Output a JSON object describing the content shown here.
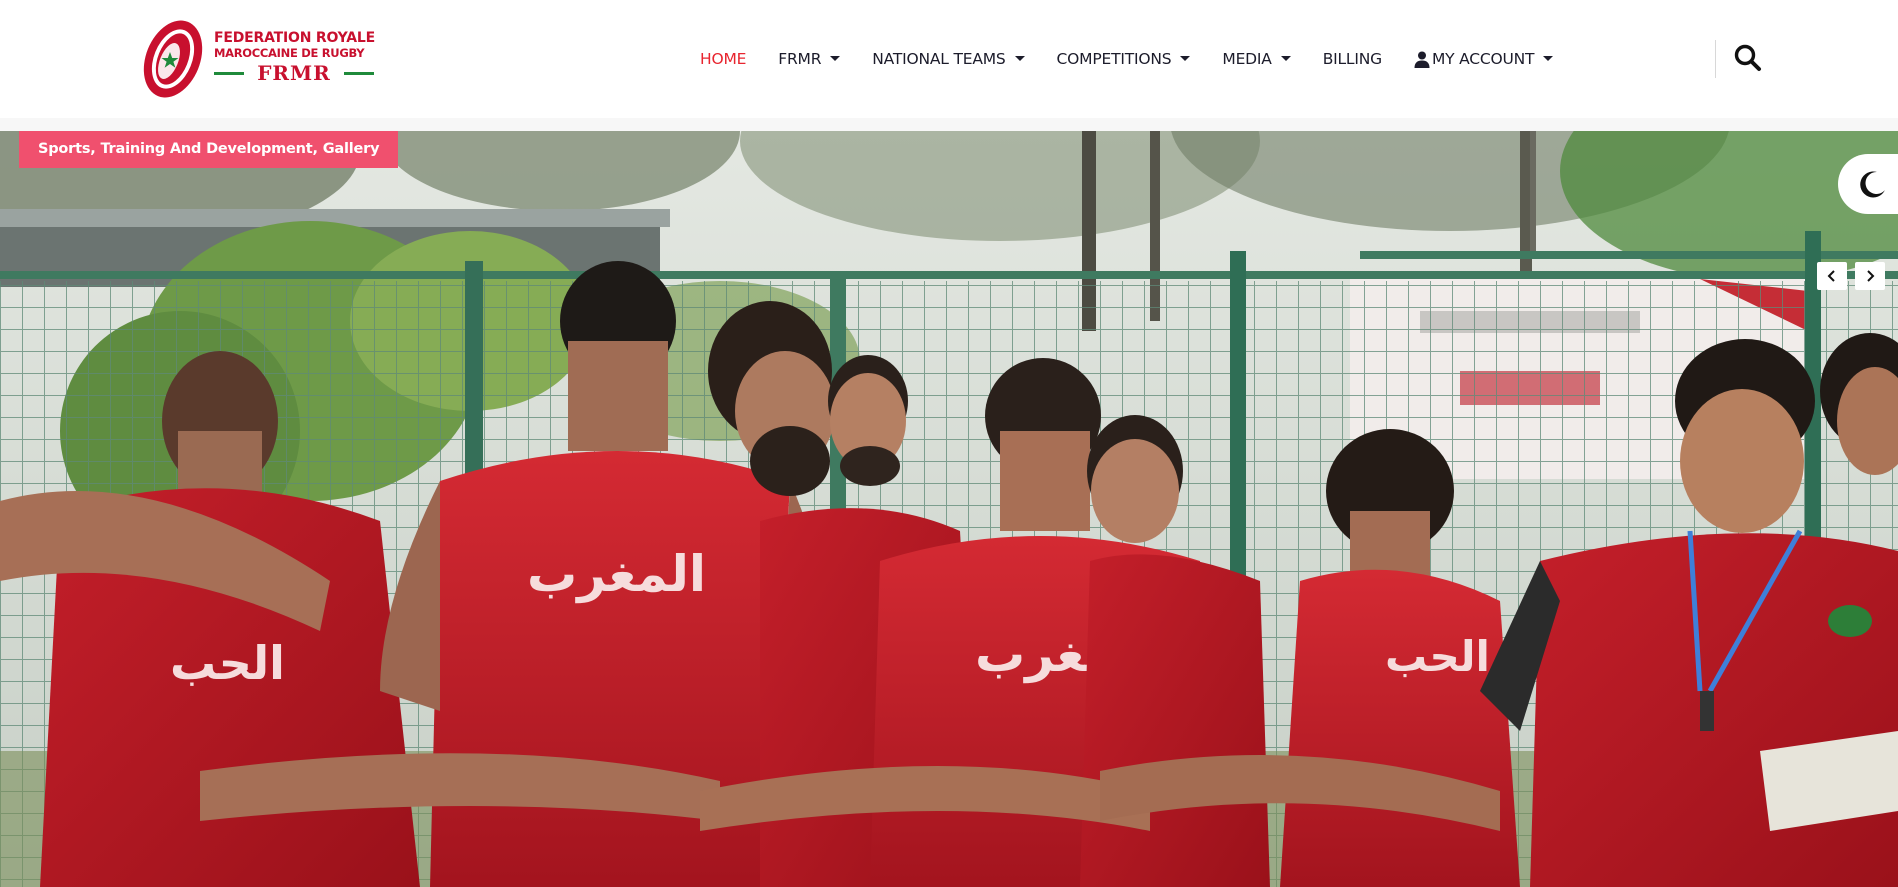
{
  "brand": {
    "name_line1": "FEDERATION ROYALE",
    "name_line2": "MAROCCAINE DE RUGBY",
    "abbreviation": "FRMR",
    "colors": {
      "red": "#c8102e",
      "green": "#1f8a3b"
    }
  },
  "nav": {
    "items": [
      {
        "label": "HOME",
        "active": true,
        "dropdown": false
      },
      {
        "label": "FRMR",
        "active": false,
        "dropdown": true
      },
      {
        "label": "NATIONAL TEAMS",
        "active": false,
        "dropdown": true
      },
      {
        "label": "COMPETITIONS",
        "active": false,
        "dropdown": true
      },
      {
        "label": "MEDIA",
        "active": false,
        "dropdown": true
      },
      {
        "label": "BILLING",
        "active": false,
        "dropdown": false
      },
      {
        "label": "MY ACCOUNT",
        "active": false,
        "dropdown": true,
        "icon": "user-icon"
      }
    ],
    "search_icon": "search-icon",
    "active_color": "#e8252f"
  },
  "hero": {
    "category": "Sports, Training And Development, Gallery",
    "category_color": "#f0506e",
    "prev_icon": "chevron-left-icon",
    "next_icon": "chevron-right-icon",
    "theme_icon": "moon-icon",
    "jersey_text": "المغرب",
    "jersey_text_partial": "الحب"
  }
}
